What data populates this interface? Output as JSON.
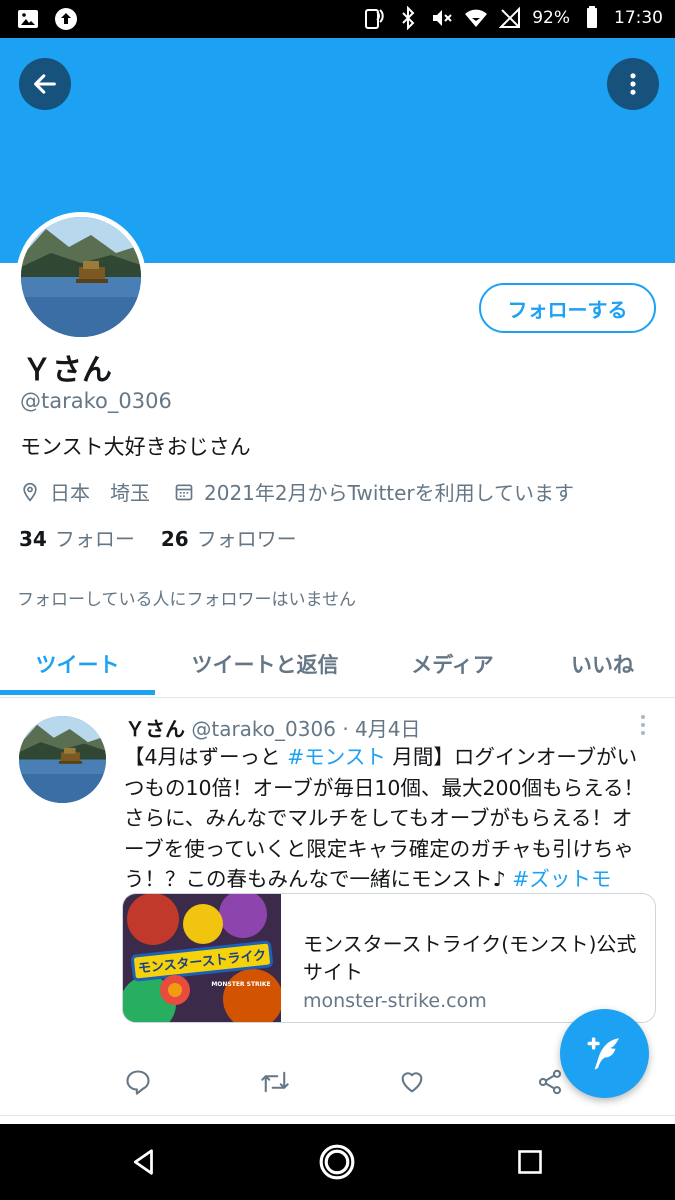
{
  "status_bar": {
    "battery": "92%",
    "time": "17:30",
    "icons": [
      "image-icon",
      "upload-icon",
      "nfc-icon",
      "bluetooth-icon",
      "mute-icon",
      "wifi-icon",
      "no-signal-icon",
      "battery-icon"
    ]
  },
  "header": {
    "back_icon": "arrow-left-icon",
    "more_icon": "more-vertical-icon",
    "banner_color": "#1da1f2"
  },
  "profile": {
    "name": "Ｙさん",
    "handle": "@tarako_0306",
    "bio": "モンスト大好きおじさん",
    "location": "日本　埼玉",
    "joined": "2021年2月からTwitterを利用しています",
    "following_count": "34",
    "following_label": "フォロー",
    "followers_count": "26",
    "followers_label": "フォロワー",
    "follow_button": "フォローする",
    "notice": "フォローしている人にフォロワーはいません"
  },
  "tabs": [
    {
      "label": "ツイート",
      "active": true
    },
    {
      "label": "ツイートと返信",
      "active": false
    },
    {
      "label": "メディア",
      "active": false
    },
    {
      "label": "いいね",
      "active": false
    }
  ],
  "tweet": {
    "name": "Ｙさん",
    "handle": "@tarako_0306",
    "separator": "·",
    "date": "4月4日",
    "text_lines": [
      {
        "pre": "【4月はずーっと ",
        "tag": "#モンスト",
        "post": " 月間】ログインオーブがい"
      },
      {
        "pre": "つもの10倍！オーブが毎日10個、最大200個もらえる！",
        "tag": "",
        "post": ""
      },
      {
        "pre": "さらに、みんなでマルチをしてもオーブがもらえる！オ",
        "tag": "",
        "post": ""
      },
      {
        "pre": "ーブを使っていくと限定キャラ確定のガチャも引けちゃ",
        "tag": "",
        "post": ""
      },
      {
        "pre": "う！？この春もみんなで一緒にモンスト♪ ",
        "tag": "#ズットモ",
        "post": ""
      }
    ],
    "card": {
      "title": "モンスターストライク(モンスト)公式サイト",
      "domain": "monster-strike.com",
      "image_logo_text": "モンスターストライク",
      "image_logo_sub": "MONSTER STRIKE"
    },
    "actions": [
      "reply-icon",
      "retweet-icon",
      "like-icon",
      "share-icon"
    ]
  },
  "fab": {
    "icon": "compose-tweet-icon"
  },
  "nav_bar": {
    "icons": [
      "nav-back-icon",
      "nav-home-icon",
      "nav-recents-icon"
    ]
  },
  "colors": {
    "accent": "#1da1f2",
    "secondary_text": "#657786",
    "dark_button": "#16527c"
  }
}
